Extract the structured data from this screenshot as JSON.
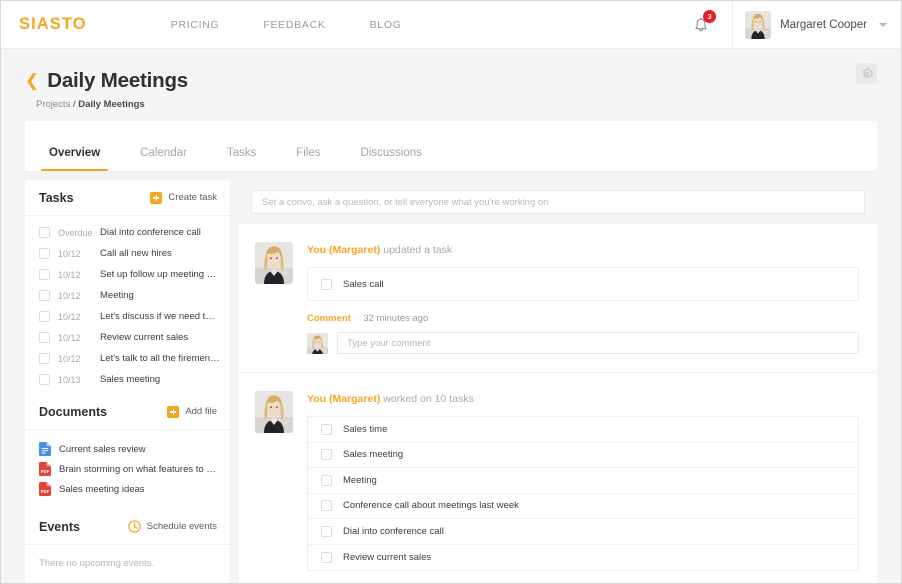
{
  "brand": {
    "name": "SIASTO",
    "color": "#f5a623"
  },
  "topnav": {
    "links": [
      {
        "label": "PRICING"
      },
      {
        "label": "FEEDBACK"
      },
      {
        "label": "BLOG"
      }
    ],
    "notifications": {
      "icon": "bell-icon",
      "count": "3"
    },
    "user": {
      "name": "Margaret Cooper",
      "avatar": "user-avatar"
    }
  },
  "page": {
    "title": "Daily Meetings",
    "back_icon": "chevron-left-icon",
    "settings_icon": "gear-icon",
    "breadcrumb": {
      "parent": "Projects",
      "separator": "/",
      "current": "Daily Meetings"
    }
  },
  "tabs": [
    {
      "label": "Overview",
      "active": true
    },
    {
      "label": "Calendar",
      "active": false
    },
    {
      "label": "Tasks",
      "active": false
    },
    {
      "label": "Files",
      "active": false
    },
    {
      "label": "Discussions",
      "active": false
    }
  ],
  "sidebar": {
    "tasks": {
      "title": "Tasks",
      "action_label": "Create task",
      "action_icon": "plus-square-icon",
      "items": [
        {
          "date": "Overdue",
          "name": "Dial into conference call"
        },
        {
          "date": "10/12",
          "name": "Call all new hires"
        },
        {
          "date": "10/12",
          "name": "Set up follow up meeting abou..."
        },
        {
          "date": "10/12",
          "name": "Meeting"
        },
        {
          "date": "10/12",
          "name": "Let's discuss if we need to ha..."
        },
        {
          "date": "10/12",
          "name": "Review current sales"
        },
        {
          "date": "10/12",
          "name": "Let's talk to all the firemen in t..."
        },
        {
          "date": "10/13",
          "name": "Sales meeting"
        }
      ]
    },
    "documents": {
      "title": "Documents",
      "action_label": "Add file",
      "action_icon": "plus-square-icon",
      "items": [
        {
          "name": "Current sales review",
          "type": "doc",
          "icon": "doc-file-icon"
        },
        {
          "name": "Brain storming on what features to buil...",
          "type": "pdf",
          "icon": "pdf-file-icon"
        },
        {
          "name": "Sales meeting ideas",
          "type": "pdf",
          "icon": "pdf-file-icon"
        }
      ]
    },
    "events": {
      "title": "Events",
      "action_label": "Schedule events",
      "action_icon": "clock-icon",
      "empty_text": "There no upcoming events."
    }
  },
  "feed": {
    "composer_placeholder": "Set a convo, ask a question, or tell everyone what you're working on",
    "items": [
      {
        "author": "You (Margaret)",
        "action": "updated a task",
        "avatar": "user-avatar",
        "tasks": [
          {
            "name": "Sales call"
          }
        ],
        "comment": {
          "label": "Comment",
          "dot": "·",
          "time": "32 minutes ago",
          "placeholder": "Type your comment",
          "avatar": "user-avatar"
        }
      },
      {
        "author": "You (Margaret)",
        "action": "worked on 10 tasks",
        "avatar": "user-avatar",
        "tasks": [
          {
            "name": "Sales time"
          },
          {
            "name": "Sales meeting"
          },
          {
            "name": "Meeting"
          },
          {
            "name": "Conference call about meetings last week"
          },
          {
            "name": "Dial into conference call"
          },
          {
            "name": "Review current sales"
          }
        ]
      }
    ]
  }
}
